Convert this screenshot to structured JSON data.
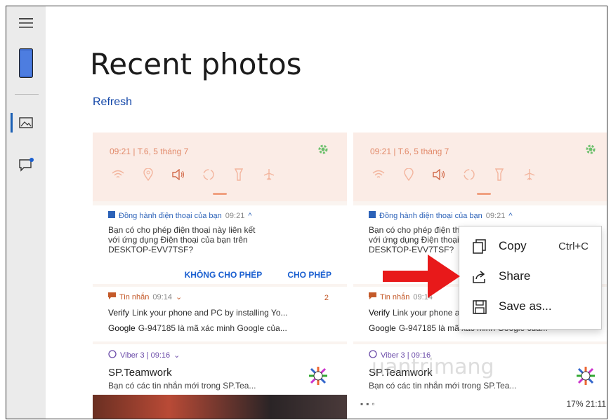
{
  "page": {
    "title": "Recent photos",
    "refresh_label": "Refresh"
  },
  "phone_card": {
    "qs_time": "09:21 | T.6, 5 tháng 7",
    "notif1": {
      "app": "Đồng hành điện thoại của bạn",
      "time": "09:21",
      "line1": "Bạn có cho phép điện thoại này liên kết",
      "line2": "với ứng dụng Điện thoại của bạn trên",
      "line3": "DESKTOP-EVV7TSF?",
      "deny": "KHÔNG CHO PHÉP",
      "allow": "CHO PHÉP"
    },
    "notif2": {
      "app": "Tin nhắn",
      "time": "09:14",
      "count": "2",
      "sender1": "Verify",
      "msg1": "Link your phone and PC by installing Yo...",
      "sender2": "Google",
      "msg2": "G-947185 là mã xác minh Google của..."
    },
    "notif3": {
      "app": "Viber 3 | 09:16",
      "title": "SP.Teamwork",
      "sub": "Bạn có các tin nhắn mới trong SP.Tea..."
    },
    "status_right": "17% 21:11"
  },
  "context_menu": {
    "items": [
      {
        "label": "Copy",
        "shortcut": "Ctrl+C",
        "icon": "copy-icon"
      },
      {
        "label": "Share",
        "shortcut": "",
        "icon": "share-icon"
      },
      {
        "label": "Save as...",
        "shortcut": "",
        "icon": "save-icon"
      }
    ]
  },
  "watermark": "uantrimang",
  "colors": {
    "accent": "#1246a8",
    "arrow": "#e8191a",
    "qs_orange": "#e28a6a"
  }
}
